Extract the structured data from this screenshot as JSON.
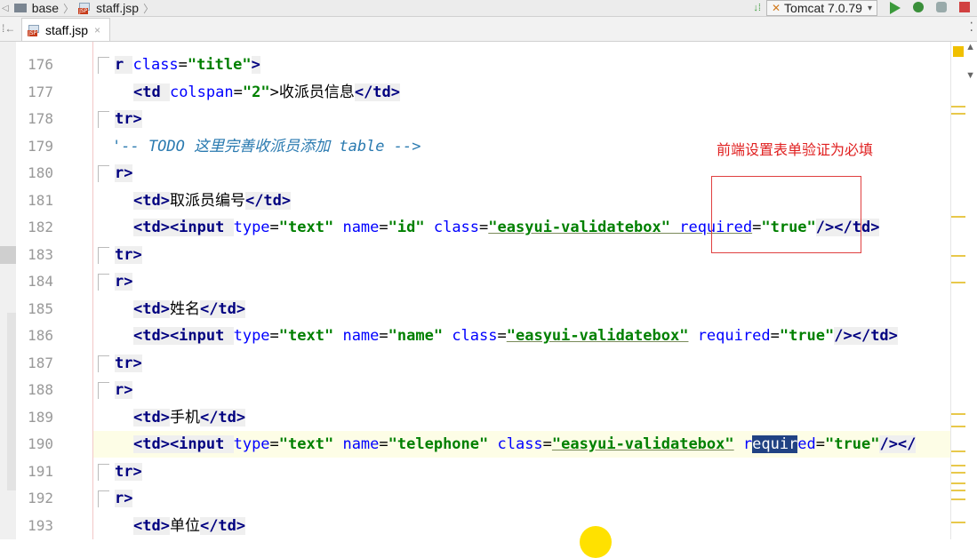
{
  "breadcrumb": {
    "folder": "base",
    "file": "staff.jsp"
  },
  "run_config": {
    "label": "Tomcat 7.0.79"
  },
  "tab": {
    "label": "staff.jsp",
    "close": "×"
  },
  "annotation": {
    "text": "前端设置表单验证为必填"
  },
  "lines": [
    {
      "n": "176",
      "html_key": "l176"
    },
    {
      "n": "177"
    },
    {
      "n": "178"
    },
    {
      "n": "179"
    },
    {
      "n": "180"
    },
    {
      "n": "181"
    },
    {
      "n": "182"
    },
    {
      "n": "183"
    },
    {
      "n": "184"
    },
    {
      "n": "185"
    },
    {
      "n": "186"
    },
    {
      "n": "187"
    },
    {
      "n": "188"
    },
    {
      "n": "189"
    },
    {
      "n": "190"
    },
    {
      "n": "191"
    },
    {
      "n": "192"
    },
    {
      "n": "193"
    }
  ],
  "code": {
    "l176_a": "r ",
    "l176_b": "class",
    "l176_c": "=",
    "l176_d": "\"title\"",
    "l176_e": ">",
    "l177_a": "<td ",
    "l177_b": "colspan",
    "l177_c": "=",
    "l177_d": "\"2\"",
    "l177_e": ">收派员信息",
    "l177_f": "</td>",
    "l178": "tr>",
    "l179": "'-- TODO 这里完善收派员添加 table -->",
    "l180": "r>",
    "l181_a": "<td>",
    "l181_b": "取派员编号",
    "l181_c": "</td>",
    "l182_a": "<td><input ",
    "l182_b": "type",
    "l182_c": "=",
    "l182_d": "\"text\"",
    "l182_e": " name",
    "l182_f": "=",
    "l182_g": "\"id\"",
    "l182_h": " class",
    "l182_i": "=",
    "l182_j": "\"easyui-validatebox\"",
    "l182_k": " required",
    "l182_l": "=",
    "l182_m": "\"true\"",
    "l182_n": "/></td>",
    "l183": "tr>",
    "l184": "r>",
    "l185_a": "<td>",
    "l185_b": "姓名",
    "l185_c": "</td>",
    "l186_a": "<td><input ",
    "l186_b": "type",
    "l186_c": "=",
    "l186_d": "\"text\"",
    "l186_e": " name",
    "l186_f": "=",
    "l186_g": "\"name\"",
    "l186_h": " class",
    "l186_i": "=",
    "l186_j": "\"easyui-validatebox\"",
    "l186_k": " required",
    "l186_l": "=",
    "l186_m": "\"true\"",
    "l186_n": "/></td>",
    "l187": "tr>",
    "l188": "r>",
    "l189_a": "<td>",
    "l189_b": "手机",
    "l189_c": "</td>",
    "l190_a": "<td><input ",
    "l190_b": "type",
    "l190_c": "=",
    "l190_d": "\"text\"",
    "l190_e": " name",
    "l190_f": "=",
    "l190_g": "\"telephone\"",
    "l190_h": " class",
    "l190_i": "=",
    "l190_j": "\"easyui-validatebox\"",
    "l190_k1": " r",
    "l190_k2": "equir",
    "l190_k3": "ed",
    "l190_l": "=",
    "l190_m": "\"true\"",
    "l190_n": "/></",
    "l191": "tr>",
    "l192": "r>",
    "l193_a": "<td>",
    "l193_b": "单位",
    "l193_c": "</td>"
  },
  "colors": {
    "annotation": "#e02020",
    "selection": "#214283",
    "tag": "#000080",
    "value": "#008000",
    "comment": "#2a7ab0"
  }
}
